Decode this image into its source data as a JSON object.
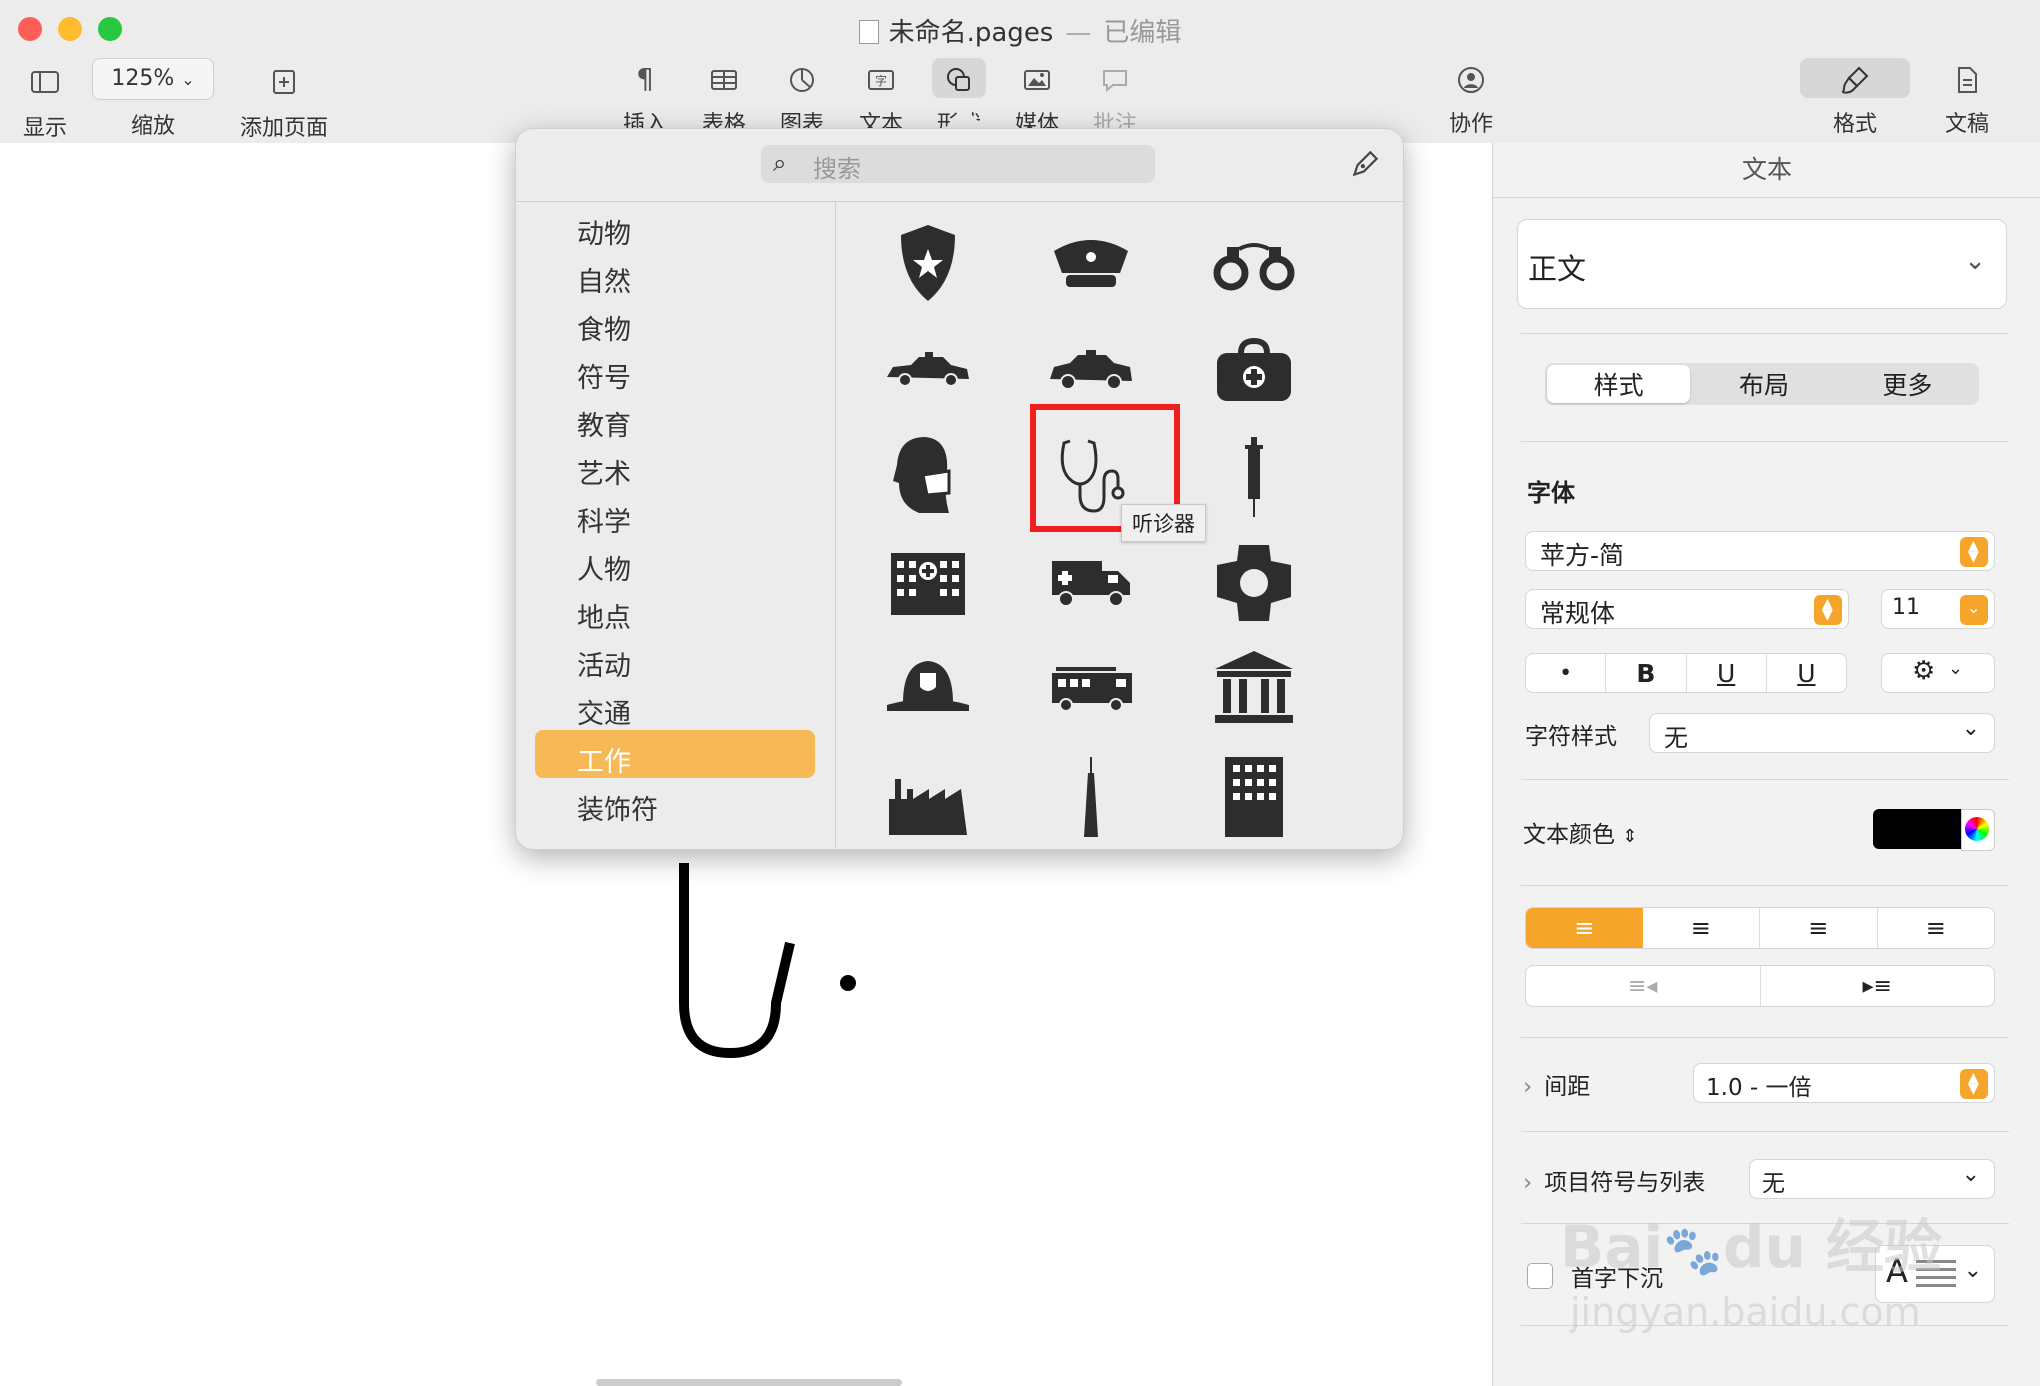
{
  "window": {
    "title_name": "未命名.pages",
    "title_sep": "—",
    "title_status": "已编辑"
  },
  "toolbar": {
    "view_label": "显示",
    "zoom_value": "125%",
    "zoom_label": "缩放",
    "add_page_label": "添加页面",
    "insert_label": "插入",
    "table_label": "表格",
    "chart_label": "图表",
    "text_label": "文本",
    "shape_label": "形状",
    "media_label": "媒体",
    "comment_label": "批注",
    "collab_label": "协作",
    "format_label": "格式",
    "document_label": "文稿"
  },
  "popover": {
    "search_placeholder": "搜索",
    "categories": [
      "动物",
      "自然",
      "食物",
      "符号",
      "教育",
      "艺术",
      "科学",
      "人物",
      "地点",
      "活动",
      "交通",
      "工作",
      "装饰符"
    ],
    "selected_category": "工作",
    "tooltip": "听诊器",
    "shapes": [
      "police-badge",
      "police-hat",
      "handcuffs",
      "police-car",
      "car",
      "medical-bag",
      "masked-head",
      "stethoscope",
      "syringe",
      "hospital",
      "ambulance",
      "fire-emblem",
      "firefighter-helmet",
      "fire-truck",
      "courthouse",
      "factory",
      "tower",
      "office-building"
    ]
  },
  "sidebar": {
    "header": "文本",
    "paragraph_style": "正文",
    "tabs": [
      "样式",
      "布局",
      "更多"
    ],
    "font_section": "字体",
    "font_family": "苹方-简",
    "font_weight": "常规体",
    "font_size": "11",
    "style_buttons": [
      "•",
      "B",
      "U",
      "U"
    ],
    "char_style_label": "字符样式",
    "char_style_value": "无",
    "text_color_label": "文本颜色",
    "text_color": "#000000",
    "accent_color": "#f5a52a",
    "spacing_label": "间距",
    "spacing_value": "1.0 - 一倍",
    "bullets_label": "项目符号与列表",
    "bullets_value": "无",
    "dropcap_label": "首字下沉",
    "dropcap_sample": "A"
  }
}
